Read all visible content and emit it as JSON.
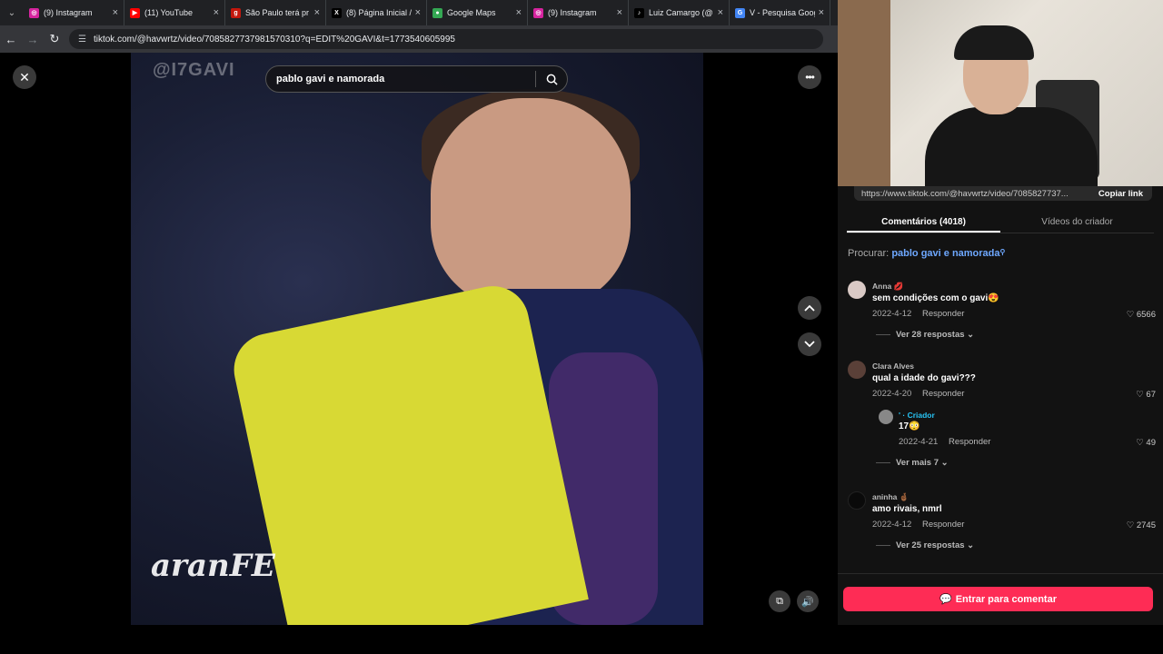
{
  "browser": {
    "tabs": [
      {
        "title": "(9) Instagram",
        "icon": "instagram-icon",
        "color": "#d6249f"
      },
      {
        "title": "(11) YouTube",
        "icon": "youtube-icon",
        "color": "#ff0000"
      },
      {
        "title": "São Paulo terá pr",
        "icon": "news-icon",
        "color": "#c4170c"
      },
      {
        "title": "(8) Página Inicial /",
        "icon": "x-icon",
        "color": "#000000"
      },
      {
        "title": "Google Maps",
        "icon": "maps-icon",
        "color": "#34a853"
      },
      {
        "title": "(9) Instagram",
        "icon": "instagram-icon",
        "color": "#d6249f"
      },
      {
        "title": "Luiz Camargo (@",
        "icon": "tiktok-icon",
        "color": "#000000"
      },
      {
        "title": "V - Pesquisa Goog",
        "icon": "google-icon",
        "color": "#4285f4"
      }
    ],
    "url": "tiktok.com/@havwrtz/video/7085827737981570310?q=EDIT%20GAVI&t=1773540605995"
  },
  "video": {
    "search_query": "pablo gavi e namorada",
    "watermark_top": "@I7GAVI",
    "watermark_bottom": "aranFE"
  },
  "panel": {
    "share_url": "https://www.tiktok.com/@havwrtz/video/7085827737...",
    "copy_link": "Copiar link",
    "tab_comments": "Comentários (4018)",
    "tab_creator": "Vídeos do criador",
    "search_label": "Procurar:",
    "search_query": "pablo gavi e namorada",
    "comments": [
      {
        "user": "Anna 💋",
        "text": "sem condições com o gavi😍",
        "date": "2022-4-12",
        "reply": "Responder",
        "likes": "6566",
        "view_replies": "Ver 28 respostas"
      },
      {
        "user": "Clara Alves",
        "text": "qual a idade do gavi???",
        "date": "2022-4-20",
        "reply": "Responder",
        "likes": "67"
      },
      {
        "user": "' · Criador",
        "text": "17😳",
        "date": "2022-4-21",
        "reply": "Responder",
        "likes": "49",
        "view_replies": "Ver mais 7"
      },
      {
        "user": "aninha 🤞🏾",
        "text": "amo rivais, nmrl",
        "date": "2022-4-12",
        "reply": "Responder",
        "likes": "2745",
        "view_replies": "Ver 25 respostas"
      }
    ],
    "enter_comment": "Entrar para comentar"
  },
  "colors": {
    "accent": "#fe2c55",
    "link": "#6ea8ff",
    "creator": "#27c4f5"
  }
}
